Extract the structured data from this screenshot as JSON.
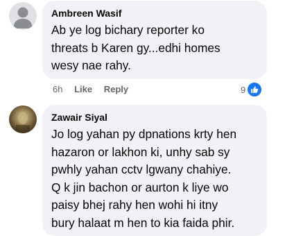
{
  "comments": [
    {
      "author": "Ambreen Wasif",
      "text": "Ab ye log bichary reporter ko\nthreats b Karen gy...edhi homes\nwesy nae rahy.",
      "time": "6h",
      "like_label": "Like",
      "reply_label": "Reply",
      "reaction_count": "9",
      "reaction_icon": "thumbs-up-icon",
      "avatar_icon": "default-avatar-icon"
    },
    {
      "author": "Zawair Siyal",
      "text": "Jo log yahan py dpnations krty hen\nhazaron or lakhon ki, unhy sab sy\npwhly yahan cctv lgwany chahiye.\nQ k jin bachon or aurton k liye wo\npaisy bhej rahy hen wohi hi itny\nbury halaat m hen to kia faida phir.",
      "avatar_icon": "profile-photo-icon"
    }
  ],
  "colors": {
    "bubble": "#f0f2f5",
    "meta_text": "#65676b",
    "like_blue": "#1877f2"
  }
}
